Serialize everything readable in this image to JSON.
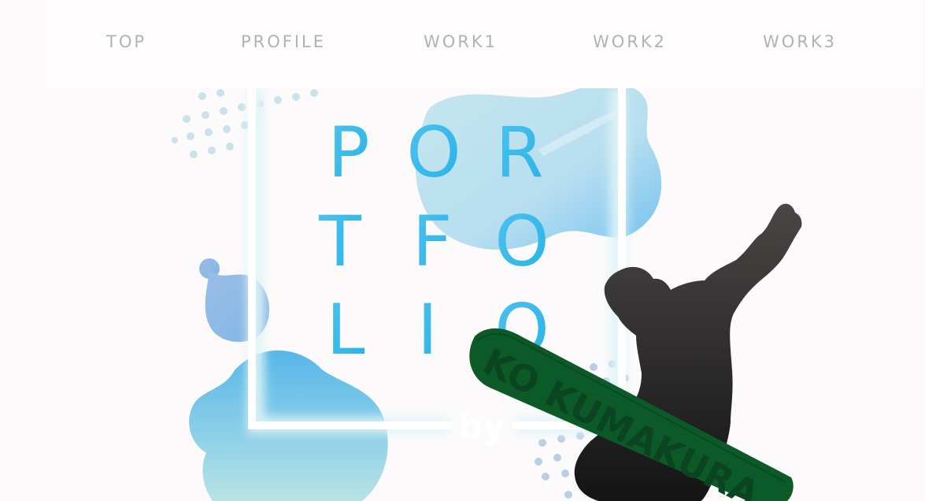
{
  "nav": {
    "items": [
      {
        "label": "TOP"
      },
      {
        "label": "PROFILE"
      },
      {
        "label": "WORK1"
      },
      {
        "label": "WORK2"
      },
      {
        "label": "WORK3"
      }
    ]
  },
  "hero": {
    "title_rows": [
      [
        "P",
        "O",
        "R"
      ],
      [
        "T",
        "F",
        "O"
      ],
      [
        "L",
        "I",
        "O"
      ]
    ],
    "byline": "by",
    "board_text": "KO KUMAKURA"
  },
  "colors": {
    "background": "#fdfafb",
    "nav_text": "#b2b2b2",
    "title_blue": "#3fb8ea",
    "blob_blue": "#6cc0ea",
    "dot_color": "#b9dde8",
    "snowboard_green": "#0e5a2a",
    "silhouette": "#2a2a2a"
  }
}
